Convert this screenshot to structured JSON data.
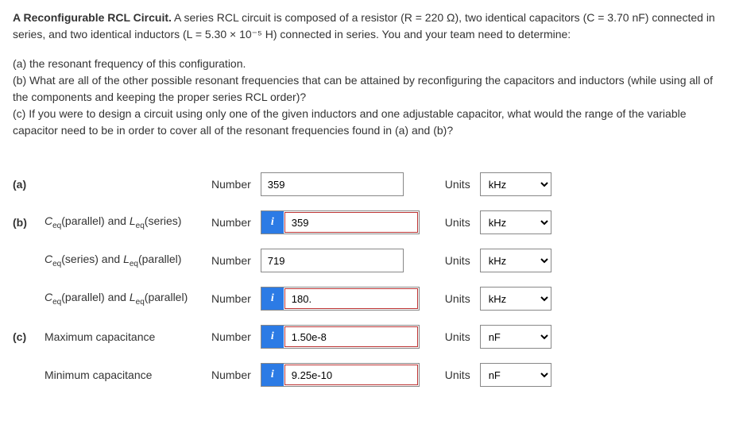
{
  "intro": {
    "title": "A Reconfigurable RCL Circuit.",
    "body": " A series RCL circuit is composed of a resistor (R = 220 Ω), two identical capacitors (C = 3.70 nF) connected in series, and two identical inductors (L = 5.30 × 10⁻⁵ H) connected in series. You and your team need to determine:"
  },
  "questions": {
    "a": "(a) the resonant frequency of this configuration.",
    "b": "(b) What are all of the other possible resonant frequencies that can be attained by reconfiguring the capacitors and inductors (while using all of the components and keeping the proper series RCL order)?",
    "c": "(c) If you were to design a circuit using only one of the given inductors and one adjustable capacitor, what would the range of the variable capacitor need to be in order to cover all of the resonant frequencies found in (a) and (b)?"
  },
  "labels": {
    "number": "Number",
    "units": "Units"
  },
  "rows": [
    {
      "part": "(a)",
      "desc_html": "",
      "has_icon": false,
      "has_red": false,
      "value": "359",
      "unit": "kHz"
    },
    {
      "part": "(b)",
      "desc_html": "Cₑq(parallel) and Lₑq(series)",
      "has_icon": true,
      "has_red": true,
      "value": "359",
      "unit": "kHz"
    },
    {
      "part": "",
      "desc_html": "Cₑq(series) and Lₑq(parallel)",
      "has_icon": false,
      "has_red": false,
      "value": "719",
      "unit": "kHz"
    },
    {
      "part": "",
      "desc_html": "Cₑq(parallel) and Lₑq(parallel)",
      "has_icon": true,
      "has_red": true,
      "value": "180.",
      "unit": "kHz"
    },
    {
      "part": "(c)",
      "desc_html": "Maximum capacitance",
      "has_icon": true,
      "has_red": true,
      "value": "1.50e-8",
      "unit": "nF"
    },
    {
      "part": "",
      "desc_html": "Minimum capacitance",
      "has_icon": true,
      "has_red": true,
      "value": "9.25e-10",
      "unit": "nF"
    }
  ]
}
